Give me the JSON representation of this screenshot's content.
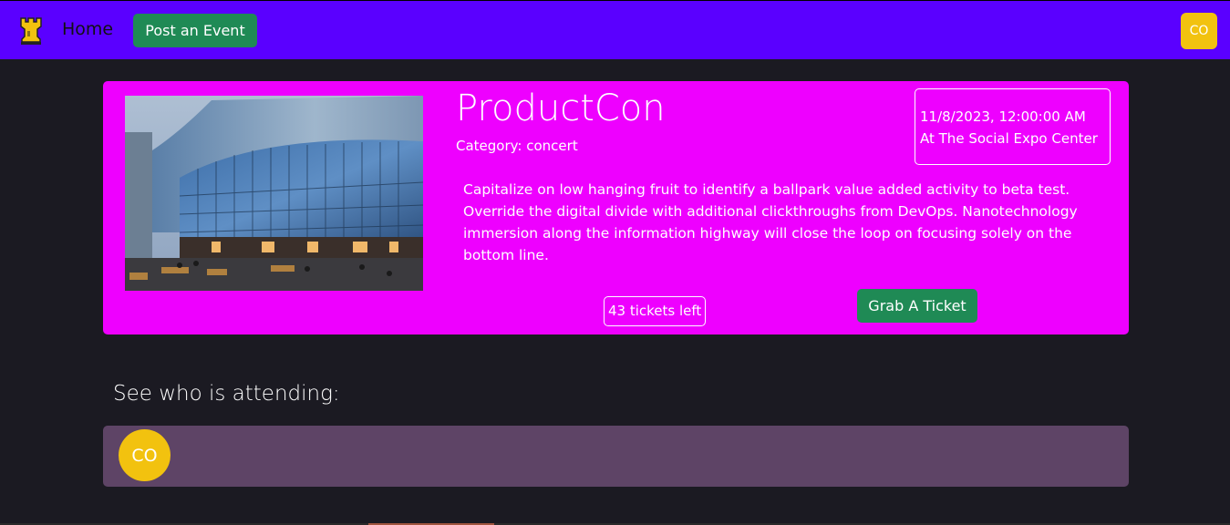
{
  "nav": {
    "logo_icon": "rook-icon",
    "home_label": "Home",
    "post_event_label": "Post an Event",
    "user_initials": "CO",
    "bar_color": "#5a00ff",
    "accent_color": "#f2c20f"
  },
  "event": {
    "title": "ProductCon",
    "category": "Category: concert",
    "date": "11/8/2023, 12:00:00 AM",
    "location": "At The Social Expo Center",
    "description": "Capitalize on low hanging fruit to identify a ballpark value added activity to beta test. Override the digital divide with additional clickthroughs from DevOps. Nanotechnology immersion along the information highway will close the loop on focusing solely on the bottom line.",
    "tickets_left": "43 tickets left",
    "grab_ticket_label": "Grab A Ticket",
    "card_color": "#ee00ff",
    "button_color": "#1f8a55"
  },
  "attendees": {
    "heading": "See who is attending:",
    "list": [
      {
        "initials": "CO"
      }
    ],
    "panel_color": "#5e4466"
  }
}
